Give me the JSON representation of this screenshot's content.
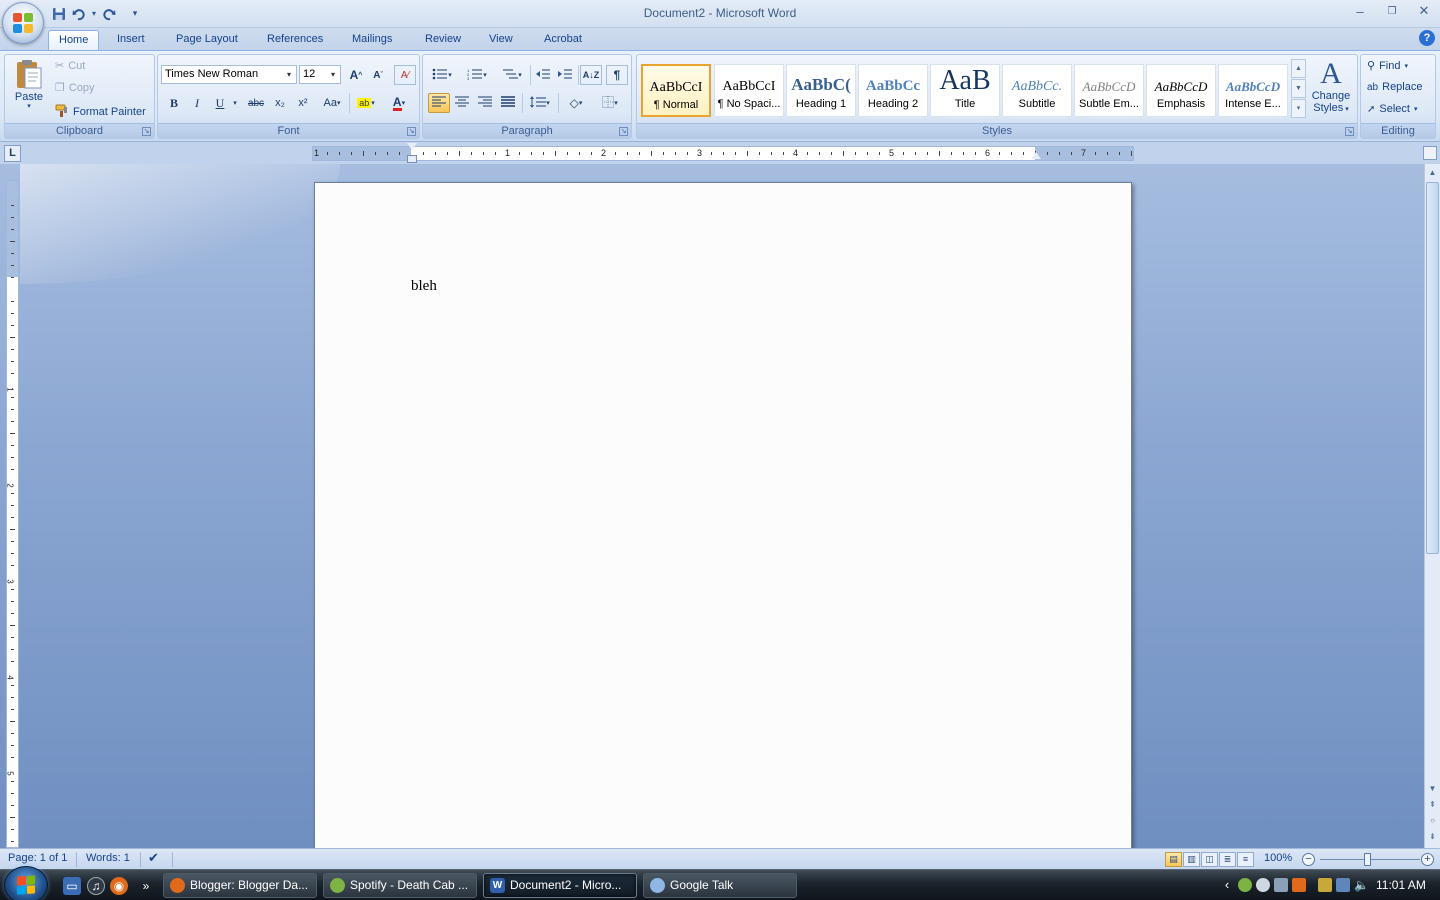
{
  "window": {
    "title": "Document2 - Microsoft Word",
    "controls": {
      "minimize": "–",
      "restore": "❐",
      "close": "✕"
    }
  },
  "qat": {
    "more": "▾"
  },
  "tabs": [
    "Home",
    "Insert",
    "Page Layout",
    "References",
    "Mailings",
    "Review",
    "View",
    "Acrobat"
  ],
  "ribbon": {
    "clipboard": {
      "label": "Clipboard",
      "paste": "Paste",
      "cut": "Cut",
      "copy": "Copy",
      "format_painter": "Format Painter"
    },
    "font": {
      "label": "Font",
      "font_name": "Times New Roman",
      "font_size": "12",
      "grow": "A",
      "shrink": "A",
      "bold": "B",
      "italic": "I",
      "underline": "U",
      "strike": "abc",
      "subscript": "x₂",
      "superscript": "x²",
      "change_case": "Aa",
      "font_color": "A"
    },
    "paragraph": {
      "label": "Paragraph",
      "show_marks": "¶"
    },
    "styles": {
      "label": "Styles",
      "items": [
        {
          "sample": "AaBbCcI",
          "name": "¶ Normal"
        },
        {
          "sample": "AaBbCcI",
          "name": "¶ No Spaci..."
        },
        {
          "sample": "AaBbC(",
          "name": "Heading 1"
        },
        {
          "sample": "AaBbCc",
          "name": "Heading 2"
        },
        {
          "sample": "AaB",
          "name": "Title"
        },
        {
          "sample": "AaBbCc.",
          "name": "Subtitle"
        },
        {
          "sample": "AaBbCcD",
          "name": "Subtle Em..."
        },
        {
          "sample": "AaBbCcD",
          "name": "Emphasis"
        },
        {
          "sample": "AaBbCcD",
          "name": "Intense E..."
        }
      ],
      "change_styles": "Change Styles",
      "change_styles_line1": "Change",
      "change_styles_line2": "Styles"
    },
    "editing": {
      "label": "Editing",
      "find": "Find",
      "replace": "Replace",
      "select": "Select"
    }
  },
  "ruler": {
    "tab_selector": "L",
    "h_numbers": [
      "1",
      "1",
      "2",
      "3",
      "4",
      "5",
      "6",
      "7"
    ],
    "v_numbers": [
      "1",
      "2",
      "3",
      "4",
      "5"
    ]
  },
  "document": {
    "text": "bleh"
  },
  "status": {
    "page": "Page: 1 of 1",
    "words": "Words: 1",
    "zoom": "100%"
  },
  "taskbar": {
    "tasks": [
      {
        "label": "Blogger: Blogger Da...",
        "color": "#e06a1c"
      },
      {
        "label": "Spotify - Death Cab ...",
        "color": "#7cb342"
      },
      {
        "label": "Document2 - Micro...",
        "color": "#2f5fad"
      },
      {
        "label": "Google Talk",
        "color": "#8fb7e6"
      }
    ],
    "overflow": "»",
    "tray_arrow": "‹",
    "clock": "11:01 AM"
  },
  "colors": {
    "accent": "#15428b",
    "ribbon_bg": "#dce8f6",
    "doc_bg": "#8ca7d2"
  }
}
